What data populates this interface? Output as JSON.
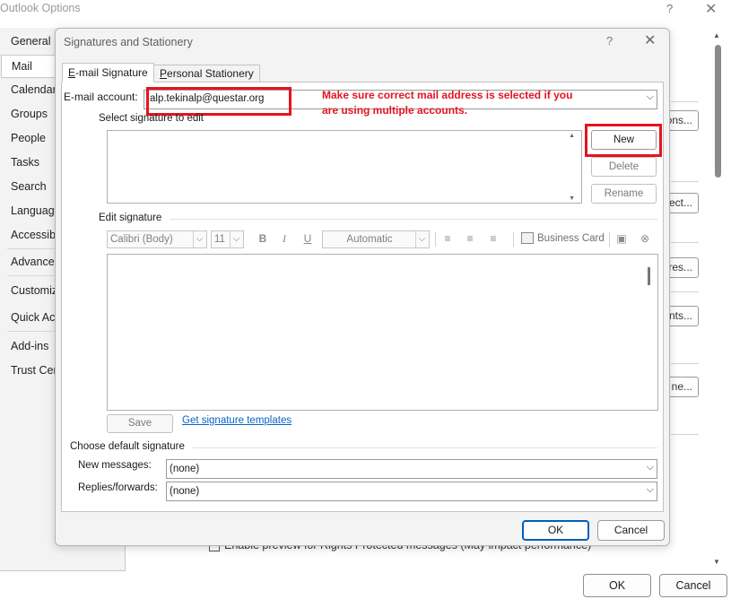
{
  "outer_window": {
    "title": "Outlook Options",
    "help_glyph": "?",
    "close_glyph": "✕",
    "nav_items": [
      "General",
      "Mail",
      "Calendar",
      "Groups",
      "People",
      "Tasks",
      "Search",
      "Language",
      "Accessibility",
      "Advanced",
      "Customize Ribbon",
      "Quick Access Toolbar",
      "Add-ins",
      "Trust Center"
    ],
    "selected_nav": "Mail",
    "button_fragments": [
      "ons...",
      "ect...",
      "res...",
      "nts...",
      "ne..."
    ],
    "checkbox_label": "Enable preview for Rights Protected messages (May impact performance)",
    "ok_label": "OK",
    "cancel_label": "Cancel"
  },
  "dialog": {
    "title": "Signatures and Stationery",
    "help_glyph": "?",
    "close_glyph": "✕",
    "tabs": [
      "E-mail Signature",
      "Personal Stationery"
    ],
    "active_tab": "E-mail Signature",
    "email_account_label": "E-mail account:",
    "email_account_value": "alp.tekinalp@questar.org",
    "annotation": "Make sure correct mail address is selected if you are using multiple accounts.",
    "select_signature_label": "Select signature to edit",
    "new_label": "New",
    "delete_label": "Delete",
    "rename_label": "Rename",
    "edit_signature_label": "Edit signature",
    "toolbar": {
      "font_family": "Calibri (Body)",
      "font_size": "11",
      "bold": "B",
      "italic": "I",
      "underline": "U",
      "color": "Automatic",
      "business_card": "Business Card"
    },
    "save_label": "Save",
    "templates_link": "Get signature templates",
    "choose_default_label": "Choose default signature",
    "new_messages_label": "New messages:",
    "new_messages_value": "(none)",
    "replies_label": "Replies/forwards:",
    "replies_value": "(none)",
    "ok_label": "OK",
    "cancel_label": "Cancel"
  },
  "colors": {
    "annotation_red": "#e4141f",
    "accent_blue": "#005fb8",
    "link_blue": "#0a63c9"
  },
  "icons": [
    "help-icon",
    "close-icon",
    "chevron-down-icon",
    "scroll-up-icon",
    "scroll-down-icon",
    "align-left-icon",
    "align-center-icon",
    "align-right-icon",
    "business-card-icon",
    "insert-picture-icon",
    "insert-hyperlink-icon"
  ]
}
